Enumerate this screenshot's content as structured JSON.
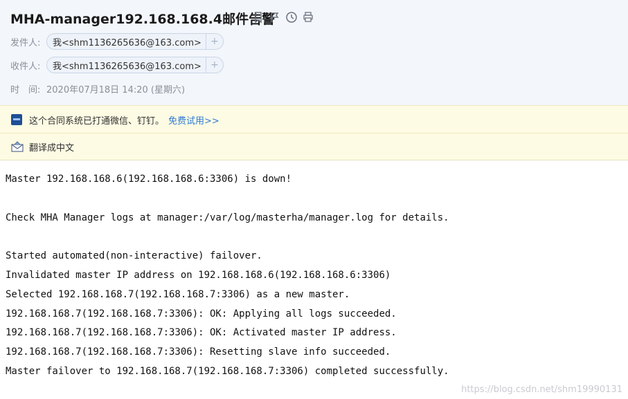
{
  "subject": "MHA-manager192.168.168.4邮件告警",
  "header_icons": [
    "bookmark-icon",
    "flag-icon",
    "clock-icon",
    "print-icon"
  ],
  "from": {
    "label": "发件人:",
    "value": "我<shm1136265636@163.com>",
    "add": "+"
  },
  "to": {
    "label": "收件人:",
    "value": "我<shm1136265636@163.com>",
    "add": "+"
  },
  "time": {
    "label": "时　间:",
    "value": "2020年07月18日 14:20 (星期六)"
  },
  "banner": {
    "text": "这个合同系统已打通微信、钉钉。",
    "link": "免费试用>>"
  },
  "translate": {
    "label": "翻译成中文"
  },
  "body_lines": [
    "Master 192.168.168.6(192.168.168.6:3306) is down!",
    "",
    "Check MHA Manager logs at manager:/var/log/masterha/manager.log for details.",
    "",
    "Started automated(non-interactive) failover.",
    "Invalidated master IP address on 192.168.168.6(192.168.168.6:3306)",
    "Selected 192.168.168.7(192.168.168.7:3306) as a new master.",
    "192.168.168.7(192.168.168.7:3306): OK: Applying all logs succeeded.",
    "192.168.168.7(192.168.168.7:3306): OK: Activated master IP address.",
    "192.168.168.7(192.168.168.7:3306): Resetting slave info succeeded.",
    "Master failover to 192.168.168.7(192.168.168.7:3306) completed successfully."
  ],
  "watermark": "https://blog.csdn.net/shm19990131",
  "colors": {
    "header_bg": "#f3f6fa",
    "banner_bg": "#fdfbe3",
    "link": "#2d7ad6"
  }
}
